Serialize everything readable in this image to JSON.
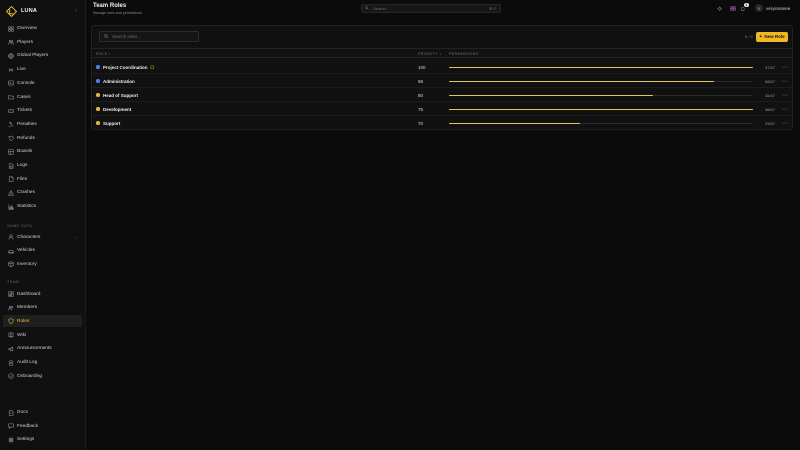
{
  "brand": {
    "name": "LUNA"
  },
  "nav": {
    "main": [
      {
        "label": "Overview",
        "icon": "grid-icon"
      },
      {
        "label": "Players",
        "icon": "users-icon"
      },
      {
        "label": "Global Players",
        "icon": "globe-icon"
      },
      {
        "label": "Live",
        "icon": "radio-icon"
      },
      {
        "label": "Console",
        "icon": "terminal-icon"
      },
      {
        "label": "Cases",
        "icon": "folder-icon"
      },
      {
        "label": "Tickets",
        "icon": "ticket-icon"
      },
      {
        "label": "Penalties",
        "icon": "gavel-icon"
      },
      {
        "label": "Refunds",
        "icon": "refund-icon"
      },
      {
        "label": "Boards",
        "icon": "board-icon"
      },
      {
        "label": "Logs",
        "icon": "logs-icon"
      },
      {
        "label": "Files",
        "icon": "file-icon"
      },
      {
        "label": "Crashes",
        "icon": "crash-icon"
      },
      {
        "label": "Statistics",
        "icon": "chart-icon"
      }
    ],
    "game_data_title": "GAME DATA",
    "game_data": [
      {
        "label": "Characters",
        "icon": "person-icon",
        "chevron": "›"
      },
      {
        "label": "Vehicles",
        "icon": "car-icon"
      },
      {
        "label": "Inventory",
        "icon": "box-icon"
      }
    ],
    "team_title": "TEAM",
    "team": [
      {
        "label": "Dashboard",
        "icon": "dashboard-icon"
      },
      {
        "label": "Members",
        "icon": "members-icon"
      },
      {
        "label": "Roles",
        "icon": "shield-icon"
      },
      {
        "label": "Wiki",
        "icon": "book-icon"
      },
      {
        "label": "Announcements",
        "icon": "megaphone-icon"
      },
      {
        "label": "Audit Log",
        "icon": "audit-icon"
      },
      {
        "label": "Onboarding",
        "icon": "onboarding-icon"
      }
    ],
    "bottom": [
      {
        "label": "Docs",
        "icon": "docs-icon"
      },
      {
        "label": "Feedback",
        "icon": "feedback-icon"
      },
      {
        "label": "Settings",
        "icon": "gear-icon"
      }
    ]
  },
  "header": {
    "title": "Team Roles",
    "subtitle": "Manage roles and permissions",
    "search_placeholder": "Search...",
    "search_shortcut": "⌘ K",
    "notification_count": "1",
    "avatar_initial": "Y",
    "username": "veryinsanee"
  },
  "roles_card": {
    "search_placeholder": "Search roles...",
    "count": "5 / 5",
    "new_button_label": "New Role",
    "columns": {
      "role": "ROLE ↕",
      "priority": "PRIORITY ↕",
      "permissions": "PERMISSIONS"
    },
    "rows": [
      {
        "name": "Project Coordination",
        "color": "#4a7ff0",
        "has_badge": true,
        "priority": "100",
        "perm_fraction": 1.0,
        "perm_text": "47/47"
      },
      {
        "name": "Administration",
        "color": "#4a7ff0",
        "has_badge": false,
        "priority": "98",
        "perm_fraction": 0.872,
        "perm_text": "58/47"
      },
      {
        "name": "Head of Support",
        "color": "#e5b53a",
        "has_badge": false,
        "priority": "80",
        "perm_fraction": 0.67,
        "perm_text": "45/47"
      },
      {
        "name": "Development",
        "color": "#e5b53a",
        "has_badge": false,
        "priority": "75",
        "perm_fraction": 1.0,
        "perm_text": "38/47"
      },
      {
        "name": "Support",
        "color": "#e5b53a",
        "has_badge": false,
        "priority": "70",
        "perm_fraction": 0.43,
        "perm_text": "29/47"
      }
    ]
  },
  "colors": {
    "accent": "#f0b823",
    "bar_fill": "#e3c362",
    "background": "#0b0b0b"
  }
}
